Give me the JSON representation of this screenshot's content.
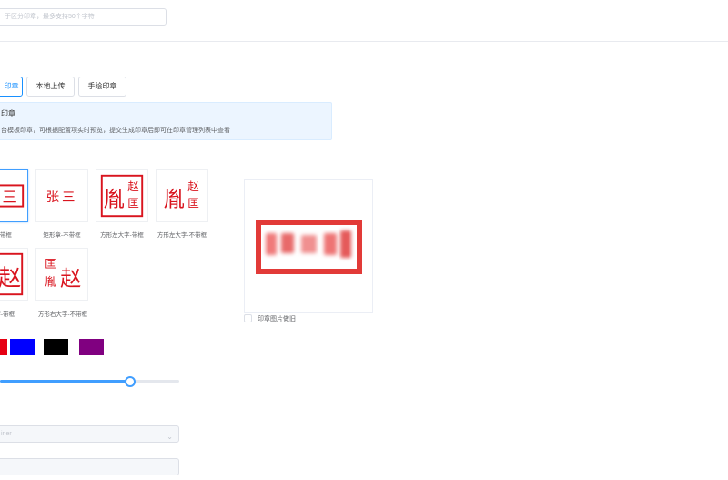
{
  "search": {
    "placeholder": "于区分印章，最多支持50个字符"
  },
  "tabs": [
    {
      "label": "印章",
      "active": true
    },
    {
      "label": "本地上传",
      "active": false
    },
    {
      "label": "手绘印章",
      "active": false
    }
  ],
  "info": {
    "title": "印章",
    "description": "台模板印章，可根据配置项实时预览，提交生成印章后即可在印章管理列表中查看"
  },
  "templates": [
    {
      "caption": "章-带框",
      "glyphs": "三",
      "selected": true
    },
    {
      "caption": "矩形章-不带框",
      "glyphs": "张三",
      "selected": false
    },
    {
      "caption": "方形左大字-带框",
      "glyphs": "胤赵匡",
      "selected": false
    },
    {
      "caption": "方形左大字-不带框",
      "glyphs": "胤赵匡",
      "selected": false
    },
    {
      "caption": "大字-带框",
      "glyphs": "赵",
      "selected": false
    },
    {
      "caption": "方形右大字-不带框",
      "glyphs": "匡胤赵",
      "selected": false
    }
  ],
  "colors": [
    {
      "name": "red",
      "hex": "#e60012"
    },
    {
      "name": "blue",
      "hex": "#0000ff"
    },
    {
      "name": "black",
      "hex": "#000000"
    },
    {
      "name": "purple",
      "hex": "#800080"
    }
  ],
  "accent_color": "#409eff",
  "seal_red": "#d9141e",
  "size_slider": {
    "value": 0.72
  },
  "font_select": {
    "value": "iner"
  },
  "preview": {
    "checkbox_label": "印章图片做旧",
    "checkbox_checked": false
  }
}
